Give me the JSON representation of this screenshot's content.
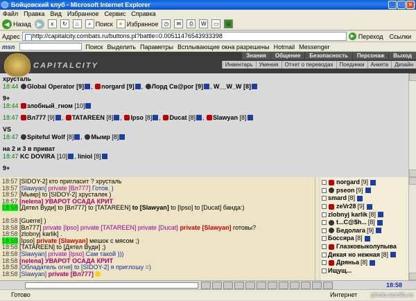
{
  "window": {
    "title": "Бойцовский клуб - Microsoft Internet Explorer"
  },
  "menu": [
    "Файл",
    "Правка",
    "Вид",
    "Избранное",
    "Сервис",
    "Справка"
  ],
  "toolbar": {
    "back": "Назад",
    "search": "Поиск",
    "favorites": "Избранное"
  },
  "address": {
    "label": "Адрес",
    "url": "http://capitalcity.combats.ru/buttons.pl?battle=0.00511476543933398",
    "go": "Переход",
    "links": "Ссылки"
  },
  "msnbar": {
    "logo": "msn",
    "search": "Поиск",
    "highlight": "Выделить",
    "options": "Параметры",
    "popups": "Всплывающие окна разрешены",
    "hotmail": "Hotmail",
    "messenger": "Messenger"
  },
  "game": {
    "brand": "CAPITALCITY",
    "nav_top": [
      "Знания",
      "Общение",
      "Безопасность",
      "Персонаж",
      "Выход"
    ],
    "nav_sub": [
      "Инвентарь",
      "Умения",
      "Отчет о переводах",
      "Поединки",
      "Анкета",
      "Дизайн"
    ]
  },
  "battle_log": {
    "r1": "хрусталь",
    "r2_time": "18:44",
    "r2_a": "Global Operator",
    "r2_b": "[9]",
    "r2_c": "norgard",
    "r2_d": "[9]",
    "r2_e": "Лорд Св@рог",
    "r2_f": "[9]",
    "r2_g": "W__W_W",
    "r2_h": "[8]",
    "r3": "9+",
    "r4_time": "18:44",
    "r4_name": "злобный_гном",
    "r4_lvl": "[10]",
    "r5_time": "18:47",
    "r5_a": "Вл777",
    "r5_b": "[9]",
    "r5_c": "TATAREEN",
    "r5_d": "[8]",
    "r5_e": "Ipso",
    "r5_f": "[8]",
    "r5_g": "Ducat",
    "r5_h": "[8]",
    "r5_i": "Slawyan",
    "r5_j": "[8]",
    "r6": "VS",
    "r7_time": "18:47",
    "r7_a": "Spiteful Wolf",
    "r7_b": "[8]",
    "r7_c": "Мымр",
    "r7_d": "[8]",
    "r8": "на 2 и 3 в приват",
    "r9_time": "18:47",
    "r9_a": "KC DOVIRA",
    "r9_b": "[10]",
    "r9_c": "liniol",
    "r9_d": "[8]",
    "r10": "9+"
  },
  "chat": {
    "c0_time": "18:57",
    "c0_text": "[SIDOY-2] кто пригласит ? хрусталь",
    "c1_time": "18:57",
    "c1_a": "[Slawyan]",
    "c1_p": "private [Вл777]",
    "c1_t": "Готов. )",
    "c2_time": "18:57",
    "c2_text": "[Мымр] to [SIDOY-2] хрусталек )",
    "c3_time": "18:57",
    "c3_text": "[nelena] УВАРОТ ОСАДА КРИТ",
    "c4_time": "18:58",
    "c4_a": "[Дятел Вуди]",
    "c4_t": "to [Вл777] to [TATAREEN]",
    "c4_b": "to [Slawyan]",
    "c4_t2": "to [Ipso] to [Ducat] банда:)",
    "c5_time": "18:58",
    "c5_text": "[Guerre] )",
    "c6_time": "18:58",
    "c6_a": "[Вл777]",
    "c6_p": "private [Ipso] private [TATAREEN] private [Ducat]",
    "c6_b": "private [Slawyan]",
    "c6_t": "готовы?",
    "c7_time": "18:58",
    "c7_text": "[zlobnyj karlik] .",
    "c8_time": "18:58",
    "c8_a": "[Ipso]",
    "c8_b": "private [Slawyan]",
    "c8_t": "мешок с мясом ;)",
    "c9_time": "18:58",
    "c9_text": "[TATAREEN] to [Дятел Вуди] ;)",
    "c10_time": "18:58",
    "c10_a": "[Slawyan]",
    "c10_p": "private [Ipso]",
    "c10_t": "Сам такой )))",
    "c11_time": "18:58",
    "c11_text": "[nelena] УВАРОТ ОСАДА КРИТ",
    "c12_time": "18:58",
    "c12_a": "[Обладатель огня]",
    "c12_t": "to [SIDOY-2] я приглошу =)",
    "c13_time": "18:58",
    "c13_a": "[Slawyan]",
    "c13_p": "private [Вл777]"
  },
  "players": [
    {
      "name": "norgard",
      "lvl": "[9]"
    },
    {
      "name": "pseon",
      "lvl": "[9]"
    },
    {
      "name": "smard",
      "lvl": "[8]"
    },
    {
      "name": "zeVr28",
      "lvl": "[9]"
    },
    {
      "name": "zlobnyj karlik",
      "lvl": "[8]"
    },
    {
      "name": "t...C@$h...",
      "lvl": "[8]"
    },
    {
      "name": "Бедолага",
      "lvl": "[9]"
    },
    {
      "name": "Боссяра",
      "lvl": "[8]"
    },
    {
      "name": "Глазковыколупыва",
      "lvl": ""
    },
    {
      "name": "Дикая но нежная",
      "lvl": "[8]"
    },
    {
      "name": "Дряньа",
      "lvl": "[8]"
    },
    {
      "name": "Ищущ...",
      "lvl": ""
    }
  ],
  "clock": "18:58",
  "status": {
    "ready": "Готово",
    "zone": "Интернет",
    "copy": "photo.scrolls.ru"
  }
}
